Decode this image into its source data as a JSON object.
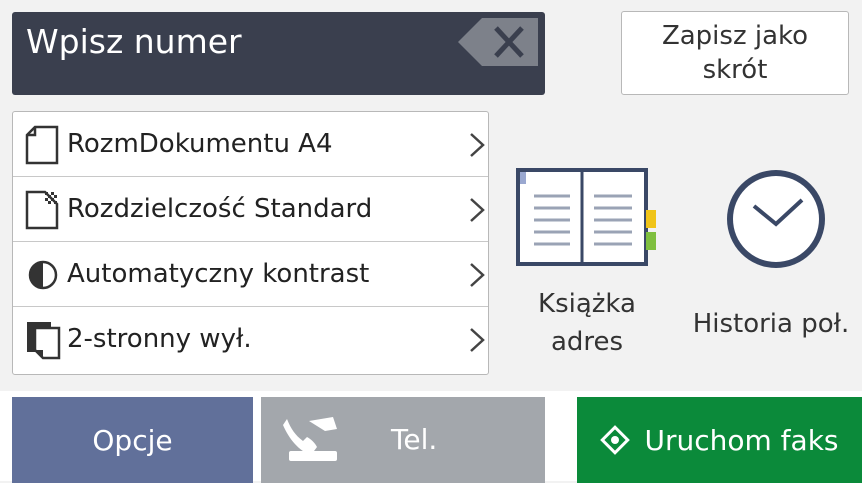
{
  "number_entry": {
    "placeholder": "Wpisz numer"
  },
  "save_shortcut": {
    "label_line1": "Zapisz jako",
    "label_line2": "skrót"
  },
  "settings": [
    {
      "label": "RozmDokumentu A4",
      "icon": "document-size-icon"
    },
    {
      "label": "Rozdzielczość Standard",
      "icon": "resolution-icon"
    },
    {
      "label": "Automatyczny kontrast",
      "icon": "contrast-icon"
    },
    {
      "label": "2-stronny wył.",
      "icon": "two-sided-icon"
    }
  ],
  "shortcuts": {
    "address_book": {
      "label_line1": "Książka",
      "label_line2": "adres",
      "icon": "address-book-icon"
    },
    "history": {
      "label": "Historia poł.",
      "icon": "clock-icon"
    }
  },
  "bottom_bar": {
    "options": "Opcje",
    "tel": "Tel.",
    "start_fax": "Uruchom faks"
  },
  "colors": {
    "number_bar": "#3a3f4e",
    "options_button": "#61709a",
    "tel_button": "#a3a7ac",
    "start_button": "#0b8a3a"
  }
}
